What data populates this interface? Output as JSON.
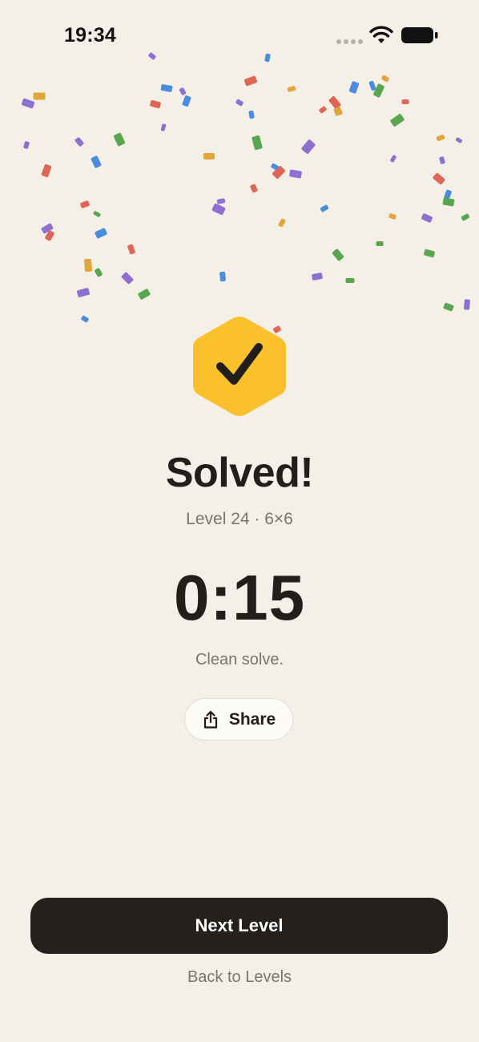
{
  "status_bar": {
    "time": "19:34"
  },
  "result": {
    "title": "Solved!",
    "subtitle": "Level 24 · 6×6",
    "time": "0:15",
    "comment": "Clean solve."
  },
  "actions": {
    "share_label": "Share",
    "next_label": "Next Level",
    "back_label": "Back to Levels"
  },
  "icons": {
    "badge": "checkmark-hexagon-icon",
    "share": "share-icon",
    "wifi": "wifi-icon",
    "battery": "battery-icon"
  },
  "colors": {
    "background": "#f4f0e8",
    "badge": "#fbc12d",
    "primary_button": "#24201c",
    "text_primary": "#211e1b",
    "text_secondary": "#7a746b",
    "confetti": [
      "#df6556",
      "#4a8ddc",
      "#8e6fd2",
      "#e2a53a",
      "#5aa550"
    ]
  }
}
